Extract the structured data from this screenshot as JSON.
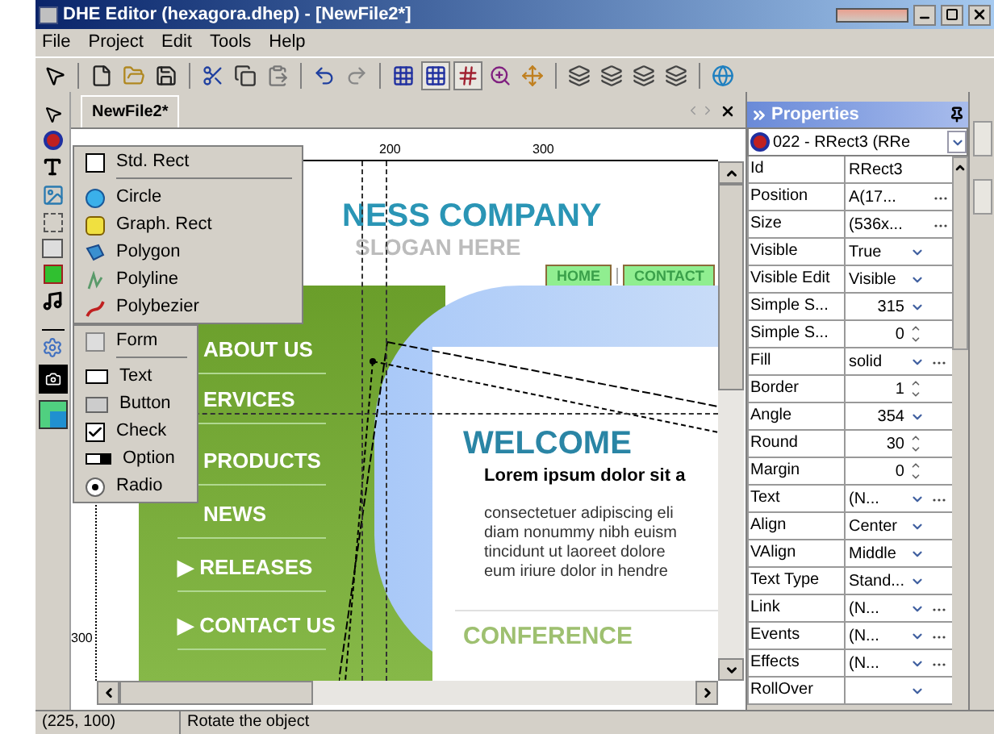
{
  "window": {
    "title": "DHE Editor (hexagora.dhep) - [NewFile2*]"
  },
  "menu": [
    "File",
    "Project",
    "Edit",
    "Tools",
    "Help"
  ],
  "toolbar": [
    {
      "kind": "pointer",
      "pressed": false
    },
    {
      "kind": "new",
      "pressed": false
    },
    {
      "kind": "open",
      "pressed": false
    },
    {
      "kind": "save",
      "pressed": false
    },
    {
      "kind": "cut",
      "pressed": false
    },
    {
      "kind": "copy",
      "pressed": false
    },
    {
      "kind": "paste",
      "pressed": false
    },
    {
      "kind": "undo",
      "pressed": false
    },
    {
      "kind": "redo",
      "pressed": false
    },
    {
      "kind": "grid",
      "pressed": false
    },
    {
      "kind": "grid",
      "pressed": true
    },
    {
      "kind": "guides",
      "pressed": true
    },
    {
      "kind": "zoom",
      "pressed": false
    },
    {
      "kind": "move",
      "pressed": false
    },
    {
      "kind": "layer",
      "pressed": false
    },
    {
      "kind": "layer",
      "pressed": false
    },
    {
      "kind": "layer",
      "pressed": false
    },
    {
      "kind": "layer",
      "pressed": false
    },
    {
      "kind": "globe",
      "pressed": false
    }
  ],
  "tabs": [
    {
      "label": "NewFile2*",
      "selected": true
    }
  ],
  "ruler": {
    "top_marks": [
      "200",
      "300"
    ],
    "left_marks": [
      "300"
    ]
  },
  "page": {
    "company": "NESS COMPANY",
    "slogan": "SLOGAN HERE",
    "top_links": [
      "HOME",
      "CONTACT"
    ],
    "nav": [
      "ABOUT US",
      "ERVICES",
      "PRODUCTS",
      "NEWS",
      "▶ RELEASES",
      "▶ CONTACT US"
    ],
    "welcome": "WELCOME",
    "lead": "Lorem ipsum dolor sit a",
    "body": [
      "consectetuer adipiscing eli",
      "diam nonummy nibh euism",
      "tincidunt ut laoreet dolore",
      "eum iriure dolor in hendre"
    ],
    "conference": "CONFERENCE"
  },
  "popup_menu": [
    [
      {
        "label": "Std. Rect",
        "kind": "rect"
      }
    ],
    [
      {
        "label": "Circle",
        "kind": "circle"
      },
      {
        "label": "Graph. Rect",
        "kind": "graph_rect"
      },
      {
        "label": "Polygon",
        "kind": "polygon"
      },
      {
        "label": "Polyline",
        "kind": "polyline"
      },
      {
        "label": "Polybezier",
        "kind": "polybezier"
      }
    ],
    [
      {
        "label": "Form",
        "kind": "form"
      }
    ],
    [
      {
        "label": "Text",
        "kind": "text"
      },
      {
        "label": "Button",
        "kind": "button"
      },
      {
        "label": "Check",
        "kind": "check"
      },
      {
        "label": "Option",
        "kind": "option"
      },
      {
        "label": "Radio",
        "kind": "radio"
      }
    ]
  ],
  "properties": {
    "title": "Properties",
    "object": "022 - RRect3 (RRe",
    "rows": [
      {
        "name": "Id",
        "value": "RRect3",
        "kind": "plain"
      },
      {
        "name": "Position",
        "value": "A(17...",
        "kind": "ellipsis"
      },
      {
        "name": "Size",
        "value": "(536x...",
        "kind": "ellipsis"
      },
      {
        "name": "Visible",
        "value": "True",
        "kind": "dropdown"
      },
      {
        "name": "Visible Edit",
        "value": "Visible",
        "kind": "dropdown"
      },
      {
        "name": "Simple S...",
        "value": "315",
        "kind": "number_dropdown"
      },
      {
        "name": "Simple S...",
        "value": "0",
        "kind": "spin"
      },
      {
        "name": "Fill",
        "value": "solid",
        "kind": "dropdown_ellipsis"
      },
      {
        "name": "Border",
        "value": "1",
        "kind": "spin"
      },
      {
        "name": "Angle",
        "value": "354",
        "kind": "number_dropdown"
      },
      {
        "name": "Round",
        "value": "30",
        "kind": "spin"
      },
      {
        "name": "Margin",
        "value": "0",
        "kind": "spin"
      },
      {
        "name": "Text",
        "value": "(N...",
        "kind": "dropdown_ellipsis"
      },
      {
        "name": "Align",
        "value": "Center",
        "kind": "dropdown"
      },
      {
        "name": "VAlign",
        "value": "Middle",
        "kind": "dropdown"
      },
      {
        "name": "Text Type",
        "value": "Stand...",
        "kind": "dropdown"
      },
      {
        "name": "Link",
        "value": "(N...",
        "kind": "dropdown_ellipsis"
      },
      {
        "name": "Events",
        "value": "(N...",
        "kind": "dropdown_ellipsis"
      },
      {
        "name": "Effects",
        "value": "(N...",
        "kind": "dropdown_ellipsis"
      },
      {
        "name": "RollOver",
        "kind": "dropdown"
      }
    ]
  },
  "status_bar": {
    "position": "(225, 100)",
    "message": "Rotate the object"
  }
}
